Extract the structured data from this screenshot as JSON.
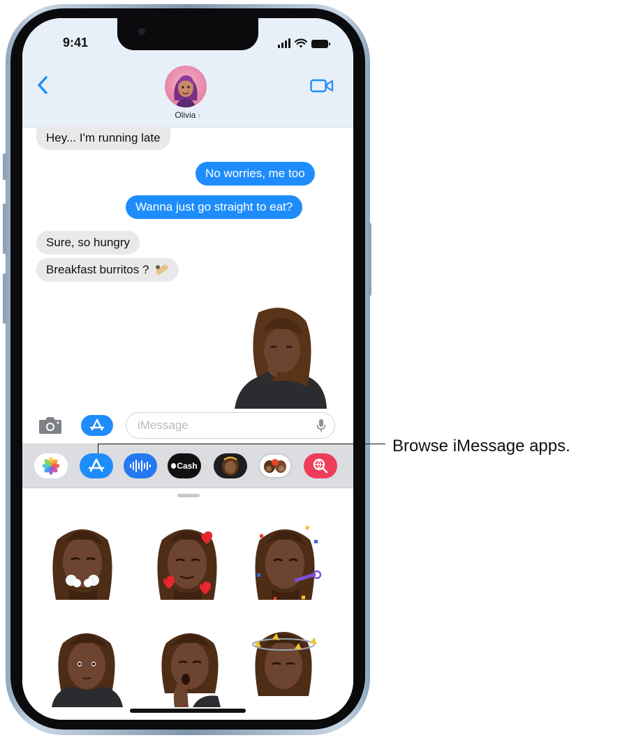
{
  "status_bar": {
    "time": "9:41",
    "icons": [
      "signal-icon",
      "wifi-icon",
      "battery-icon"
    ]
  },
  "header": {
    "back_icon": "chevron-left-icon",
    "contact_name": "Olivia",
    "video_icon": "video-camera-icon"
  },
  "conversation": [
    {
      "from": "contact",
      "text": "Hey... I'm running late"
    },
    {
      "from": "me",
      "text": "No worries, me too"
    },
    {
      "from": "me",
      "text": "Wanna just go straight to eat?"
    },
    {
      "from": "contact",
      "text": "Sure, so hungry"
    },
    {
      "from": "contact",
      "text": "Breakfast burritos ?",
      "emoji": "burrito-emoji"
    },
    {
      "from": "me",
      "sticker": "memoji-sticker-eating"
    }
  ],
  "composer": {
    "camera_icon": "camera-icon",
    "apps_icon": "app-store-icon",
    "placeholder": "iMessage",
    "value": "",
    "mic_icon": "microphone-icon"
  },
  "app_drawer": {
    "apps": [
      {
        "name": "photos",
        "icon": "photos-icon"
      },
      {
        "name": "app-store",
        "icon": "app-store-icon"
      },
      {
        "name": "audio-message",
        "icon": "waveform-icon"
      },
      {
        "name": "apple-cash",
        "icon": "apple-cash-icon",
        "label": "Cash"
      },
      {
        "name": "memoji",
        "icon": "memoji-icon"
      },
      {
        "name": "memoji-stickers",
        "icon": "memoji-stickers-icon"
      },
      {
        "name": "images-search",
        "icon": "globe-search-icon"
      }
    ],
    "stickers": [
      "memoji-sneezing",
      "memoji-hearts",
      "memoji-party",
      "memoji-thinking",
      "memoji-yawning",
      "memoji-dizzy"
    ]
  },
  "callout": {
    "text": "Browse iMessage apps."
  },
  "colors": {
    "bubble_out": "#1e8dfb",
    "bubble_in": "#e9e9eb",
    "accent": "#1e8dfb",
    "header_bg": "#e7f0f9",
    "frame": "#8fa6bd"
  }
}
